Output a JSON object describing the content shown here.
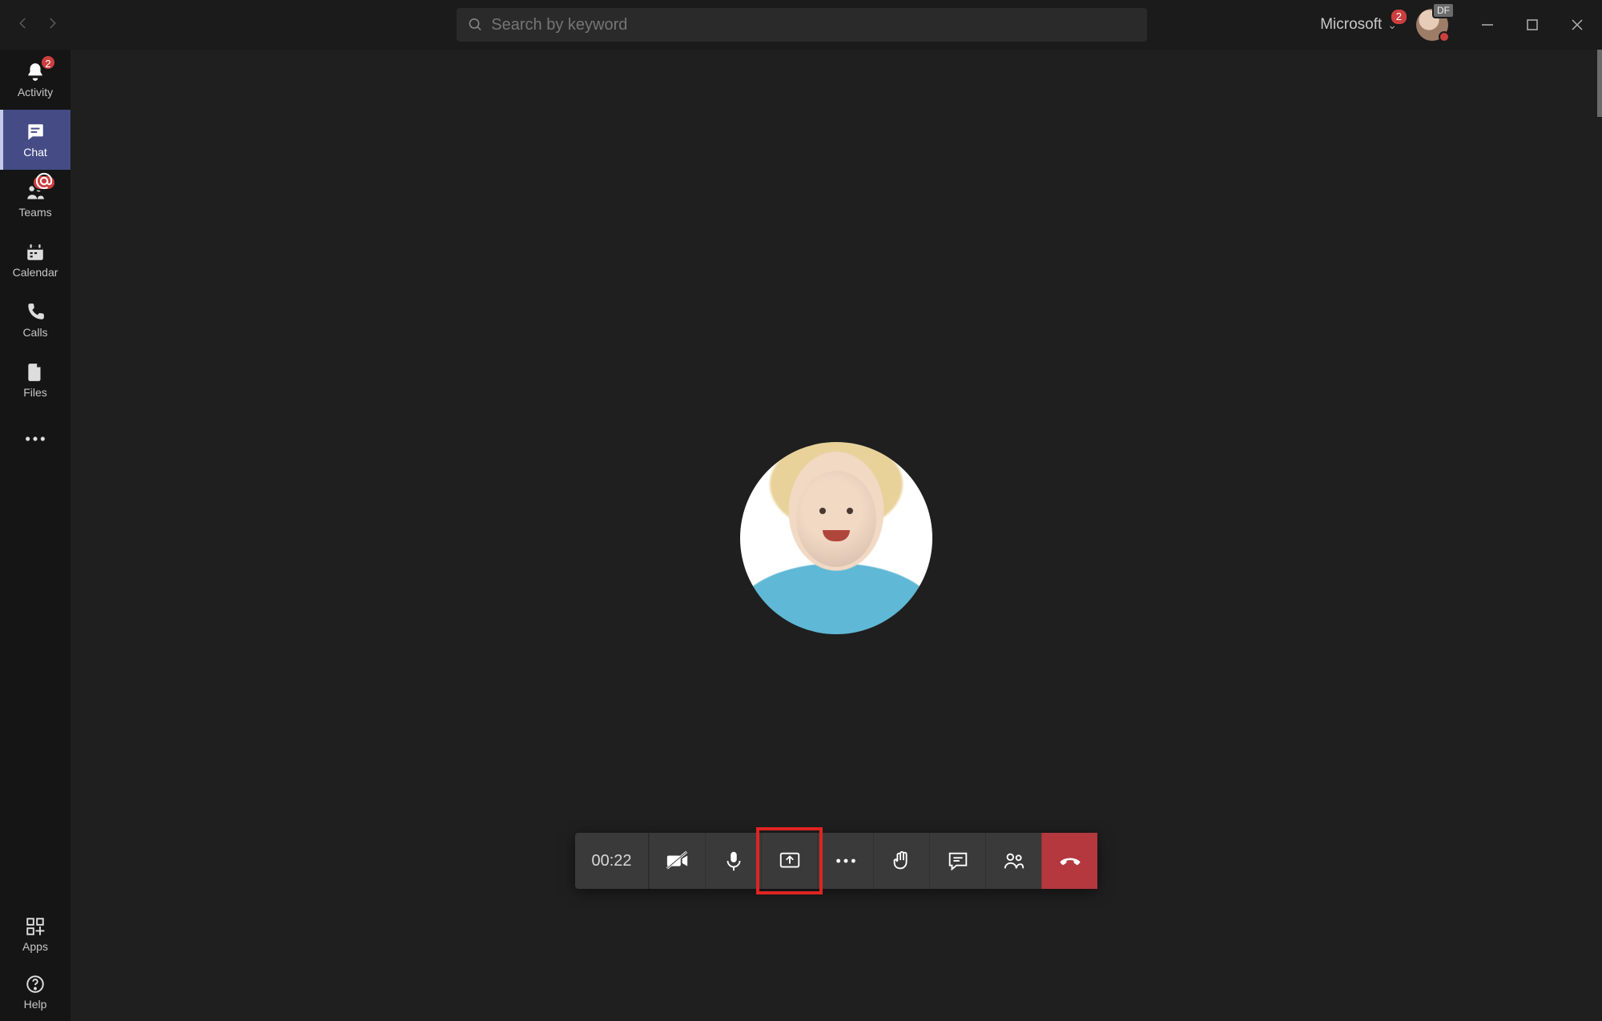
{
  "titlebar": {
    "search_placeholder": "Search by keyword",
    "org_label": "Microsoft",
    "org_notification_count": "2",
    "avatar_initials": "DF"
  },
  "rail": {
    "activity": {
      "label": "Activity",
      "badge": "2"
    },
    "chat": {
      "label": "Chat"
    },
    "teams": {
      "label": "Teams",
      "badge": "@"
    },
    "calendar": {
      "label": "Calendar"
    },
    "calls": {
      "label": "Calls"
    },
    "files": {
      "label": "Files"
    },
    "apps": {
      "label": "Apps"
    },
    "help": {
      "label": "Help"
    }
  },
  "call": {
    "timer": "00:22"
  }
}
